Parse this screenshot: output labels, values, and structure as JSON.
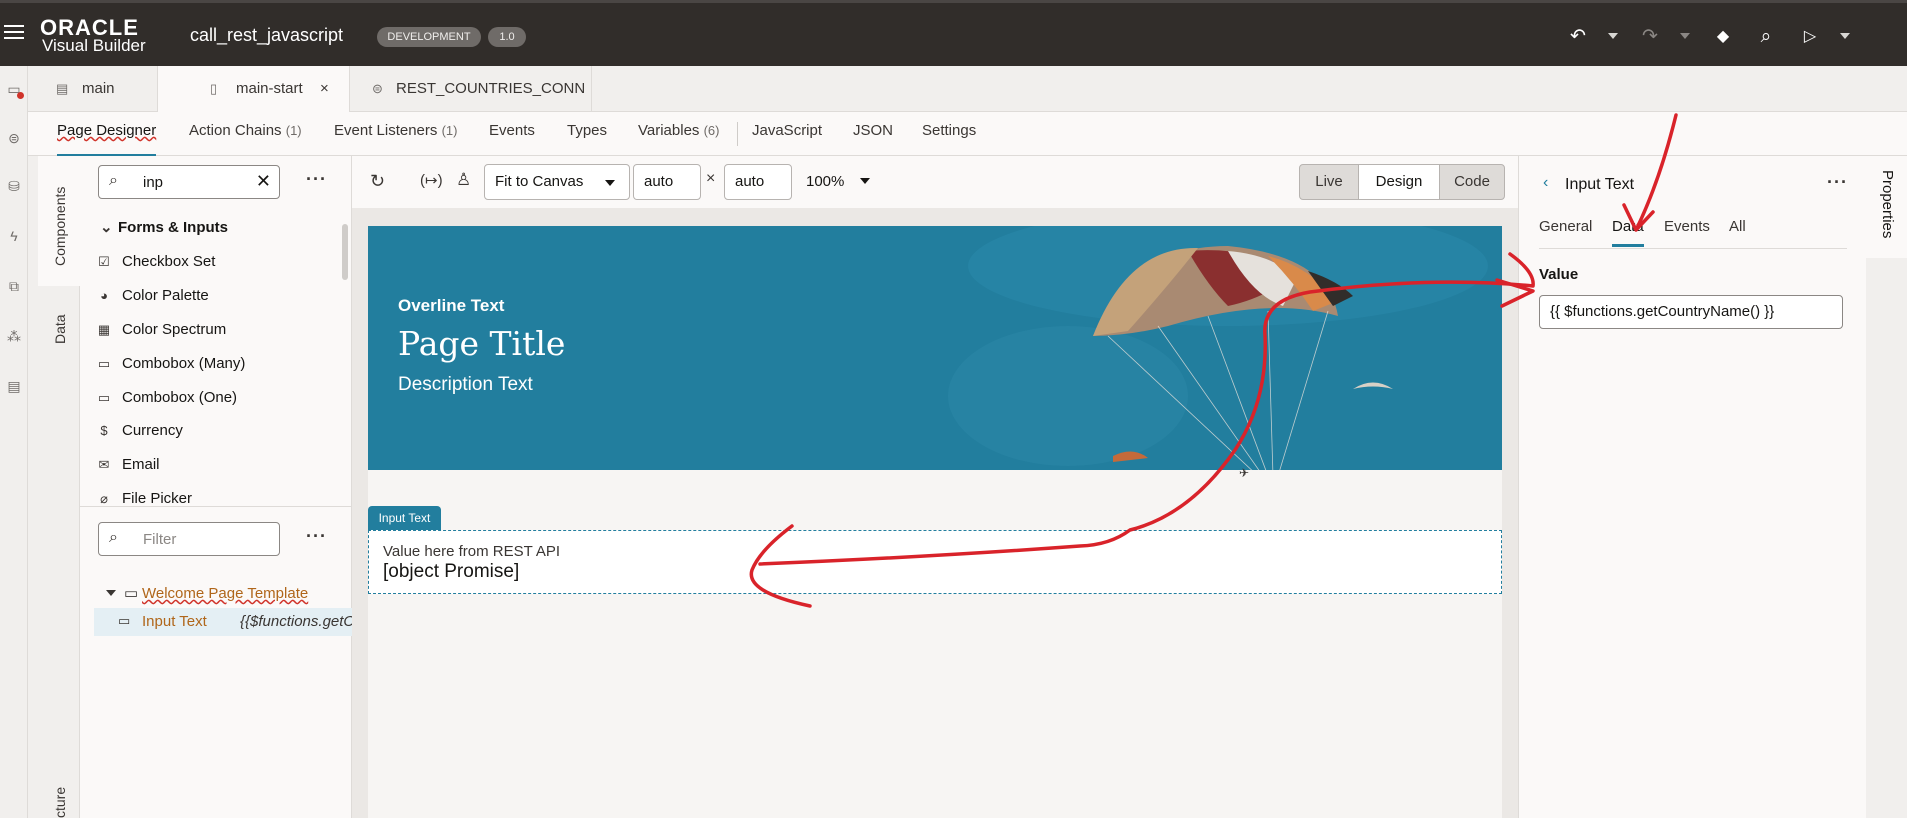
{
  "topbar": {
    "logo_brand": "ORACLE",
    "logo_product": "Visual Builder",
    "app_name": "call_rest_javascript",
    "env_badge": "DEVELOPMENT",
    "version_badge": "1.0"
  },
  "file_tabs": [
    {
      "label": "main"
    },
    {
      "label": "main-start"
    },
    {
      "label": "REST_COUNTRIES_CONN"
    }
  ],
  "sub_tabs": {
    "page_designer": "Page Designer",
    "action_chains": "Action Chains",
    "action_chains_count": "(1)",
    "event_listeners": "Event Listeners",
    "event_listeners_count": "(1)",
    "events": "Events",
    "types": "Types",
    "variables": "Variables",
    "variables_count": "(6)",
    "javascript": "JavaScript",
    "json": "JSON",
    "settings": "Settings"
  },
  "vertical_tabs": {
    "components": "Components",
    "data": "Data",
    "structure": "cture"
  },
  "components": {
    "search_value": "inp",
    "group": "Forms & Inputs",
    "items": [
      {
        "label": "Checkbox Set",
        "icon": "checkbox-set-icon"
      },
      {
        "label": "Color Palette",
        "icon": "palette-icon"
      },
      {
        "label": "Color Spectrum",
        "icon": "spectrum-icon"
      },
      {
        "label": "Combobox (Many)",
        "icon": "combobox-icon"
      },
      {
        "label": "Combobox (One)",
        "icon": "combobox-icon"
      },
      {
        "label": "Currency",
        "icon": "dollar-icon"
      },
      {
        "label": "Email",
        "icon": "mail-icon"
      },
      {
        "label": "File Picker",
        "icon": "paperclip-icon"
      }
    ]
  },
  "structure": {
    "filter_placeholder": "Filter",
    "root": "Welcome Page Template",
    "child_label": "Input Text",
    "child_value": "{{$functions.getC"
  },
  "canvas_toolbar": {
    "fit": "Fit to Canvas",
    "width": "auto",
    "times": "×",
    "height": "auto",
    "zoom": "100%",
    "live": "Live",
    "design": "Design",
    "code": "Code"
  },
  "page": {
    "overline": "Overline Text",
    "title": "Page Title",
    "description": "Description Text",
    "component_tag": "Input Text",
    "input_label": "Value here from REST API",
    "input_value": "[object Promise]"
  },
  "properties": {
    "title": "Input Text",
    "tabs": [
      "General",
      "Data",
      "Events",
      "All"
    ],
    "value_label": "Value",
    "value": "{{ $functions.getCountryName() }}",
    "rail_label": "Properties"
  },
  "colors": {
    "accent": "#227e9e",
    "topbar": "#312d2a",
    "annotation": "#d9232a"
  }
}
